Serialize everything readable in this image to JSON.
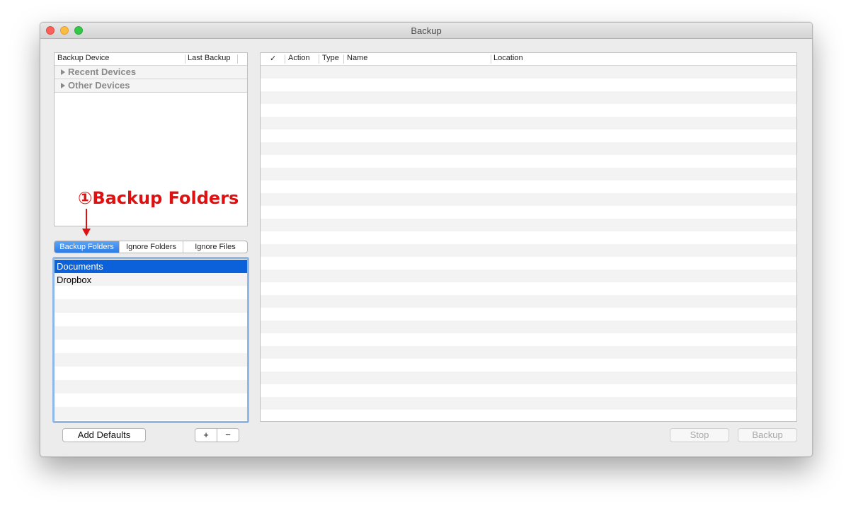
{
  "window": {
    "title": "Backup"
  },
  "devices": {
    "columns": {
      "device": "Backup Device",
      "last_backup": "Last Backup"
    },
    "groups": [
      "Recent Devices",
      "Other Devices"
    ]
  },
  "annotation": {
    "label": "①Backup Folders"
  },
  "tabs": {
    "backup_folders": "Backup Folders",
    "ignore_folders": "Ignore Folders",
    "ignore_files": "Ignore Files"
  },
  "folders": {
    "items": [
      "Documents",
      "Dropbox"
    ]
  },
  "results": {
    "columns": {
      "check": "✓",
      "action": "Action",
      "type": "Type",
      "name": "Name",
      "location": "Location"
    }
  },
  "buttons": {
    "add_defaults": "Add Defaults",
    "plus": "+",
    "minus": "−",
    "stop": "Stop",
    "backup": "Backup"
  },
  "colors": {
    "selection": "#0b61d9",
    "annotation": "#e01010",
    "tab_active": "#2b7ce8"
  }
}
